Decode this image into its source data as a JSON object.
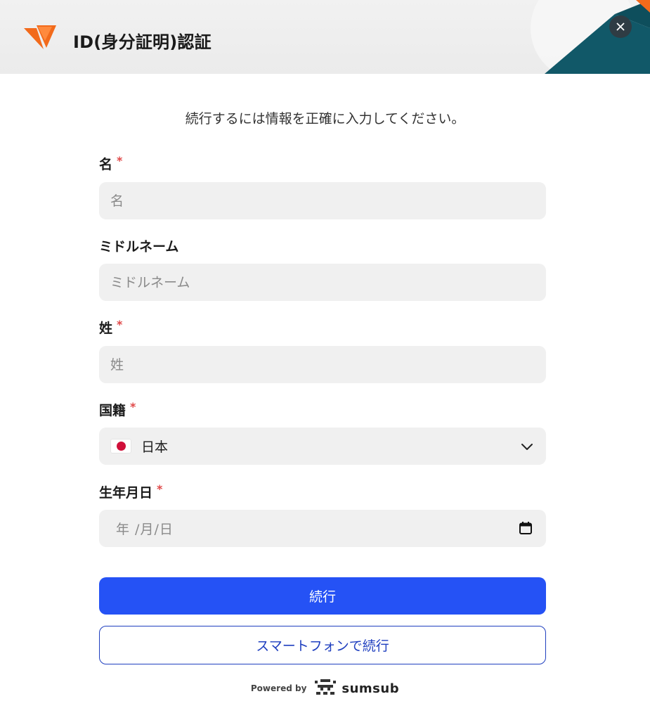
{
  "header": {
    "title": "ID(身分証明)認証",
    "close_label": "×"
  },
  "subtitle": "続行するには情報を正確に入力してください。",
  "form": {
    "first_name": {
      "label": "名",
      "required_mark": "*",
      "placeholder": "名",
      "value": ""
    },
    "middle_name": {
      "label": "ミドルネーム",
      "placeholder": "ミドルネーム",
      "value": ""
    },
    "last_name": {
      "label": "姓",
      "required_mark": "*",
      "placeholder": "姓",
      "value": ""
    },
    "nationality": {
      "label": "国籍",
      "required_mark": "*",
      "selected": "日本",
      "flag": "japan-flag"
    },
    "birth_date": {
      "label": "生年月日",
      "required_mark": "*",
      "placeholder": "年 /月/日"
    }
  },
  "buttons": {
    "continue": "続行",
    "continue_on_phone": "スマートフォンで続行"
  },
  "footer": {
    "powered_by": "Powered by",
    "brand": "sumsub"
  },
  "colors": {
    "primary": "#2552f5",
    "secondary_border": "#1f3fbf",
    "required": "#e04848",
    "logo_orange": "#f26a1b",
    "field_bg": "#f0f0f0"
  }
}
